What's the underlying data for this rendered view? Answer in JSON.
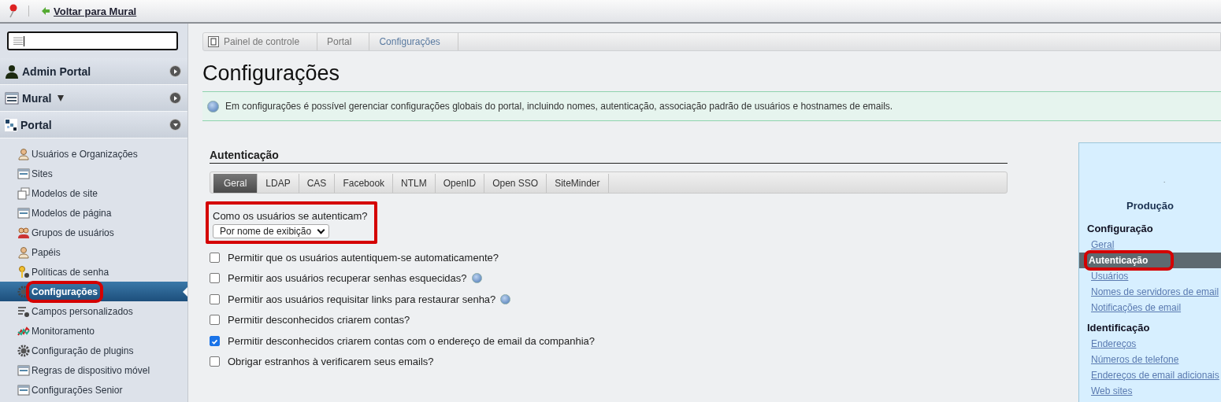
{
  "topbar": {
    "back_link": "Voltar para Mural"
  },
  "sidebar": {
    "sections": [
      {
        "title": "Admin Portal",
        "kind": "user",
        "dropdown": false,
        "expanded": false
      },
      {
        "title": "Mural",
        "kind": "site",
        "dropdown": true,
        "expanded": false
      },
      {
        "title": "Portal",
        "kind": "grid",
        "dropdown": false,
        "expanded": true
      }
    ],
    "items": [
      {
        "label": "Usuários e Organizações",
        "kind": "user",
        "selected": false,
        "highlighted": false
      },
      {
        "label": "Sites",
        "kind": "window",
        "selected": false,
        "highlighted": false
      },
      {
        "label": "Modelos de site",
        "kind": "stack",
        "selected": false,
        "highlighted": false
      },
      {
        "label": "Modelos de página",
        "kind": "window",
        "selected": false,
        "highlighted": false
      },
      {
        "label": "Grupos de usuários",
        "kind": "group",
        "selected": false,
        "highlighted": false
      },
      {
        "label": "Papéis",
        "kind": "user",
        "selected": false,
        "highlighted": false
      },
      {
        "label": "Políticas de senha",
        "kind": "key",
        "selected": false,
        "highlighted": false
      },
      {
        "label": "Configurações",
        "kind": "gear",
        "selected": true,
        "highlighted": true
      },
      {
        "label": "Campos personalizados",
        "kind": "gearlist",
        "selected": false,
        "highlighted": false
      },
      {
        "label": "Monitoramento",
        "kind": "chart",
        "selected": false,
        "highlighted": false
      },
      {
        "label": "Configuração de plugins",
        "kind": "gear",
        "selected": false,
        "highlighted": false
      },
      {
        "label": "Regras de dispositivo móvel",
        "kind": "window",
        "selected": false,
        "highlighted": false
      },
      {
        "label": "Configurações Senior",
        "kind": "window",
        "selected": false,
        "highlighted": false
      }
    ]
  },
  "breadcrumb": [
    {
      "label": "Painel de controle",
      "current": false
    },
    {
      "label": "Portal",
      "current": false
    },
    {
      "label": "Configurações",
      "current": true
    }
  ],
  "page_title": "Configurações",
  "info": "Em configurações é possível gerenciar configurações globais do portal, incluindo nomes, autenticação, associação padrão de usuários e hostnames de emails.",
  "section_title": "Autenticação",
  "tabs": [
    {
      "label": "Geral",
      "selected": true
    },
    {
      "label": "LDAP",
      "selected": false
    },
    {
      "label": "CAS",
      "selected": false
    },
    {
      "label": "Facebook",
      "selected": false
    },
    {
      "label": "NTLM",
      "selected": false
    },
    {
      "label": "OpenID",
      "selected": false
    },
    {
      "label": "Open SSO",
      "selected": false
    },
    {
      "label": "SiteMinder",
      "selected": false
    }
  ],
  "auth_select": {
    "label": "Como os usuários se autenticam?",
    "value": "Por nome de exibição",
    "highlighted": true
  },
  "options": [
    {
      "label": "Permitir que os usuários autentiquem-se automaticamente?",
      "checked": false,
      "help": false
    },
    {
      "label": "Permitir aos usuários recuperar senhas esquecidas?",
      "checked": false,
      "help": true
    },
    {
      "label": "Permitir aos usuários requisitar links para restaurar senha?",
      "checked": false,
      "help": true
    },
    {
      "label": "Permitir desconhecidos criarem contas?",
      "checked": false,
      "help": false
    },
    {
      "label": "Permitir desconhecidos criarem contas com o endereço de email da companhia?",
      "checked": true,
      "help": false
    },
    {
      "label": "Obrigar estranhos à verificarem seus emails?",
      "checked": false,
      "help": false
    }
  ],
  "right_panel": {
    "logo_text": ".",
    "title": "Produção",
    "groups": [
      {
        "title": "Configuração",
        "items": [
          {
            "label": "Geral",
            "selected": false,
            "highlighted": false
          },
          {
            "label": "Autenticação",
            "selected": true,
            "highlighted": true
          },
          {
            "label": "Usuários",
            "selected": false,
            "highlighted": false
          },
          {
            "label": "Nomes de servidores de email",
            "selected": false,
            "highlighted": false
          },
          {
            "label": "Notificações de email",
            "selected": false,
            "highlighted": false
          }
        ]
      },
      {
        "title": "Identificação",
        "items": [
          {
            "label": "Endereços",
            "selected": false,
            "highlighted": false
          },
          {
            "label": "Números de telefone",
            "selected": false,
            "highlighted": false
          },
          {
            "label": "Endereços de email adicionais",
            "selected": false,
            "highlighted": false
          },
          {
            "label": "Web sites",
            "selected": false,
            "highlighted": false
          }
        ]
      }
    ]
  }
}
